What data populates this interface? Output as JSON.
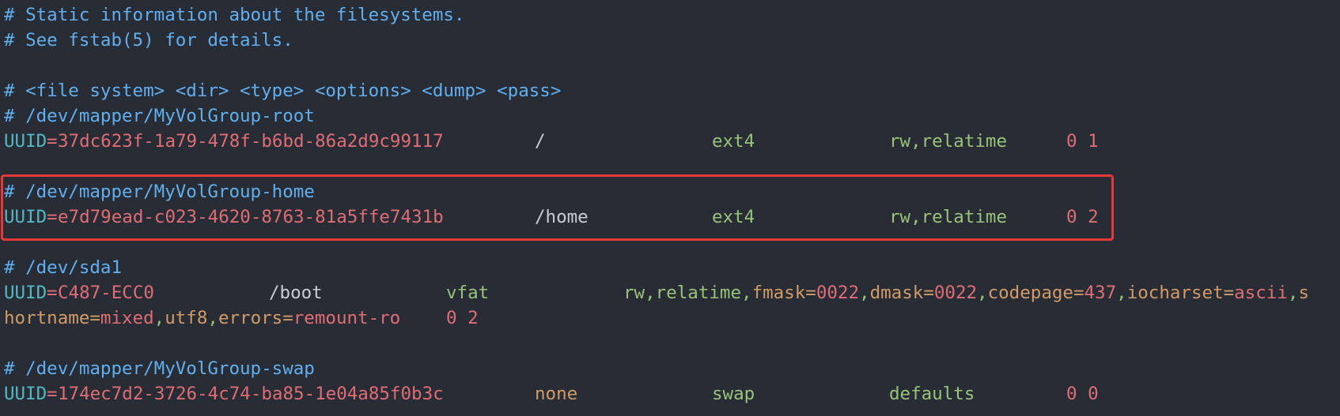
{
  "file": {
    "line_0": "# Static information about the filesystems.",
    "line_1": "# See fstab(5) for details.",
    "line_3": "# <file system> <dir> <type> <options> <dump> <pass>",
    "root": {
      "comment": "# /dev/mapper/MyVolGroup-root",
      "key": "UUID",
      "eq": "=",
      "uuid": "37dc623f-1a79-478f-b6bd-86a2d9c99117",
      "dir": "/",
      "type": "ext4",
      "opt_rw": "rw",
      "opt_comma": ",",
      "opt_relatime": "relatime",
      "pass": "0 1"
    },
    "home": {
      "comment": "# /dev/mapper/MyVolGroup-home",
      "key": "UUID",
      "eq": "=",
      "uuid": "e7d79ead-c023-4620-8763-81a5ffe7431b",
      "dir": "/home",
      "type": "ext4",
      "opt_rw": "rw",
      "opt_comma": ",",
      "opt_relatime": "relatime",
      "pass": "0 2"
    },
    "boot": {
      "comment": "# /dev/sda1",
      "key": "UUID",
      "eq": "=",
      "uuid": "C487-ECC0",
      "dir": "/boot",
      "type": "vfat",
      "opts_line1": {
        "a": "rw",
        "b": ",",
        "c": "relatime",
        "d": ",",
        "e": "fmask",
        "f": "=",
        "g": "0022",
        "h": ",",
        "i": "dmask",
        "j": "=",
        "k": "0022",
        "l": ",",
        "m": "codepage",
        "n": "=",
        "o": "437",
        "p": ",",
        "q": "iocharset",
        "r": "=",
        "s": "ascii",
        "t": ",",
        "u": "s"
      },
      "opts_line2": {
        "a": "hortname",
        "b": "=",
        "c": "mixed",
        "d": ",",
        "e": "utf8",
        "f": ",",
        "g": "errors",
        "h": "=",
        "i": "remount-ro"
      },
      "pass": "0 2"
    },
    "swap": {
      "comment": "# /dev/mapper/MyVolGroup-swap",
      "key": "UUID",
      "eq": "=",
      "uuid": "174ec7d2-3726-4c74-ba85-1e04a85f0b3c",
      "dir": "none",
      "type": "swap",
      "opts": "defaults",
      "pass": "0 0"
    }
  },
  "colors": {
    "background": "#282c34",
    "comment": "#61afef",
    "uuid_key": "#56b6c2",
    "uuid_value": "#e06c75",
    "type": "#98c379",
    "option_key": "#d19a66",
    "highlight_border": "#e5383b"
  }
}
